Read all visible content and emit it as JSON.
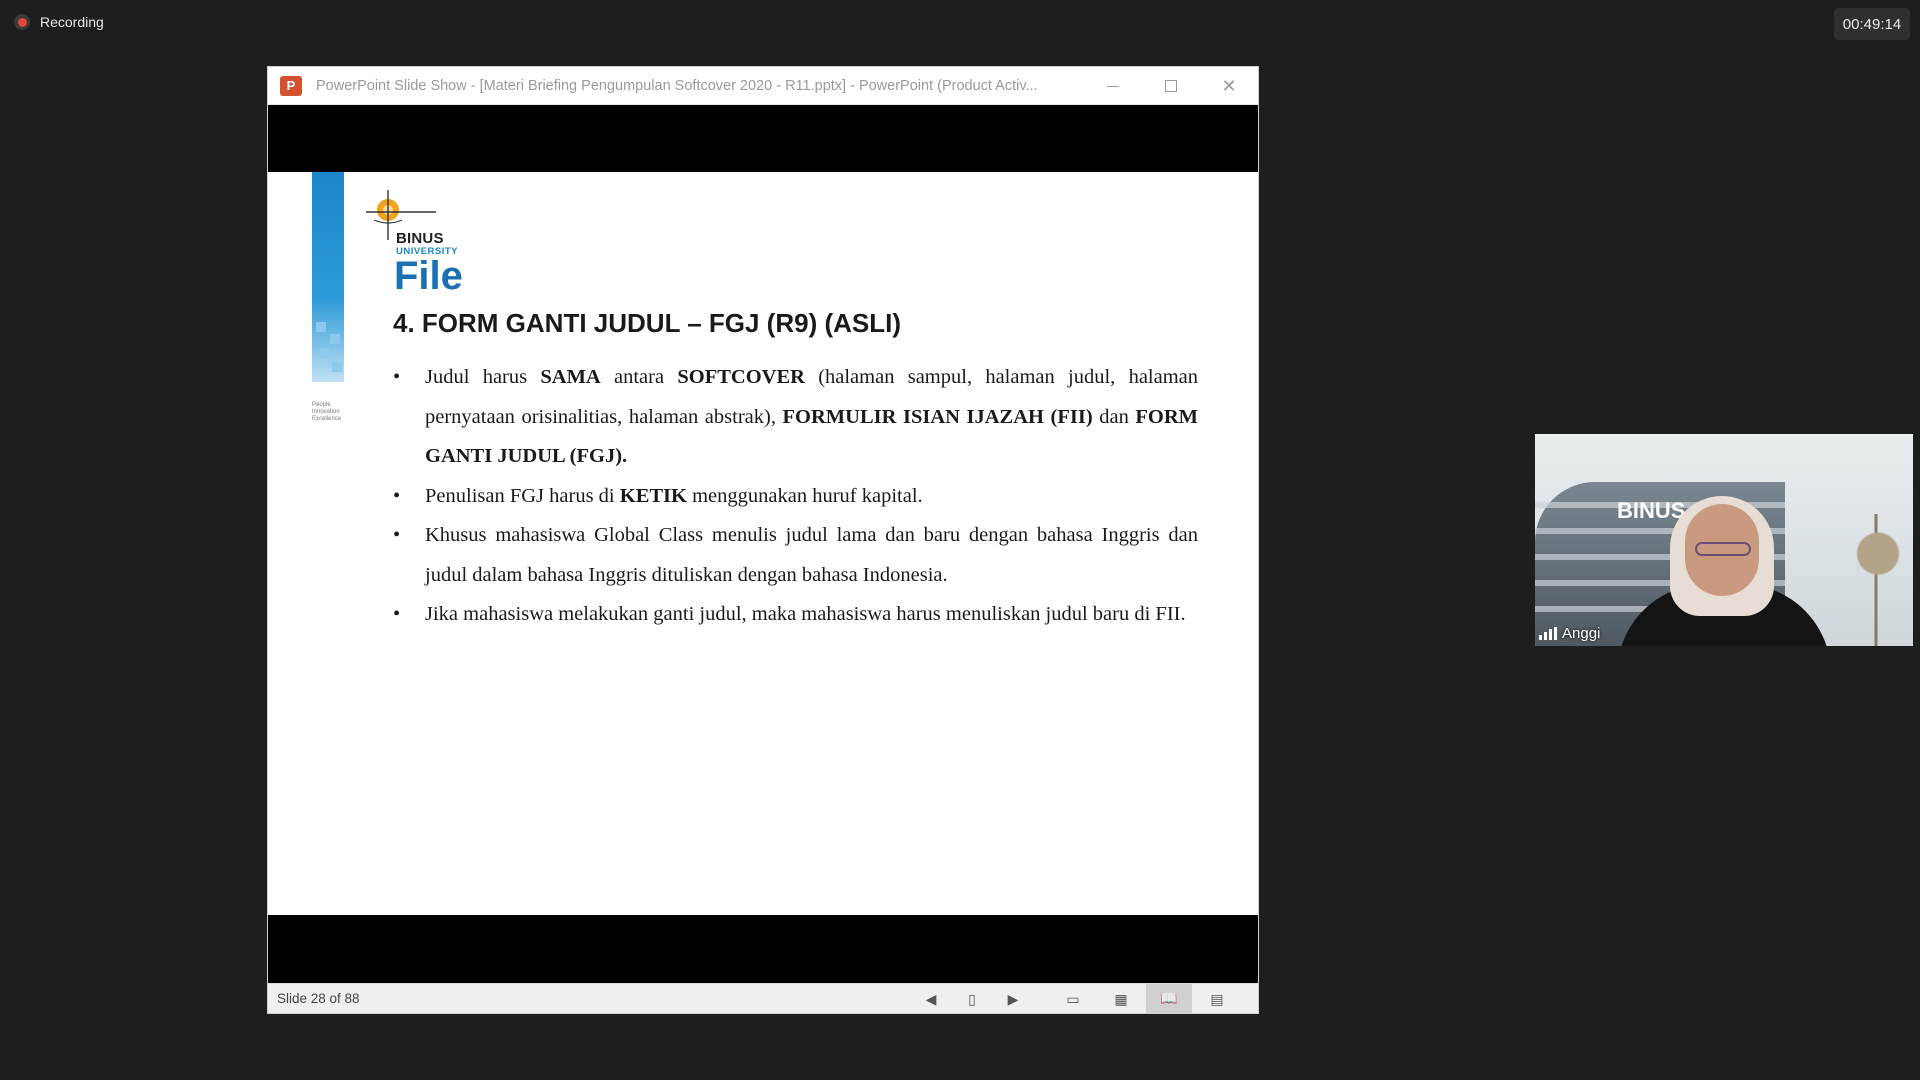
{
  "meeting": {
    "recording_label": "Recording",
    "timer": "00:49:14"
  },
  "powerpoint": {
    "window_title": "PowerPoint Slide Show - [Materi Briefing Pengumpulan Softcover 2020 - R11.pptx] - PowerPoint (Product Activ...",
    "app_icon_letter": "P",
    "status": {
      "slide_counter": "Slide 28 of 88"
    },
    "slide": {
      "logo_text": "BINUS",
      "logo_subtext": "UNIVERSITY",
      "file_label": "File",
      "side_note": "People Innovation Excellence",
      "title": "4. FORM GANTI JUDUL – FGJ (R9) (ASLI)",
      "bullets": [
        {
          "parts": [
            "Judul harus ",
            "SAMA",
            " antara ",
            "SOFTCOVER",
            " (halaman sampul, halaman judul, halaman pernyataan orisinalitias, halaman abstrak), ",
            "FORMULIR ISIAN IJAZAH (FII)",
            " dan ",
            "FORM GANTI JUDUL (FGJ)."
          ]
        },
        {
          "parts": [
            "Penulisan FGJ harus di ",
            "KETIK",
            " menggunakan huruf kapital."
          ]
        },
        {
          "parts": [
            "Khusus mahasiswa Global Class menulis judul lama dan baru dengan bahasa Inggris dan judul dalam bahasa Inggris dituliskan dengan bahasa Indonesia."
          ]
        },
        {
          "parts": [
            "Jika mahasiswa melakukan ganti judul, maka mahasiswa harus menuliskan judul baru di FII."
          ]
        }
      ]
    }
  },
  "participant": {
    "name": "Anggi",
    "background_label": "BINUS"
  },
  "colors": {
    "accent_blue": "#1b86c9",
    "recording_red": "#e3453b",
    "ppt_orange": "#d35230"
  }
}
